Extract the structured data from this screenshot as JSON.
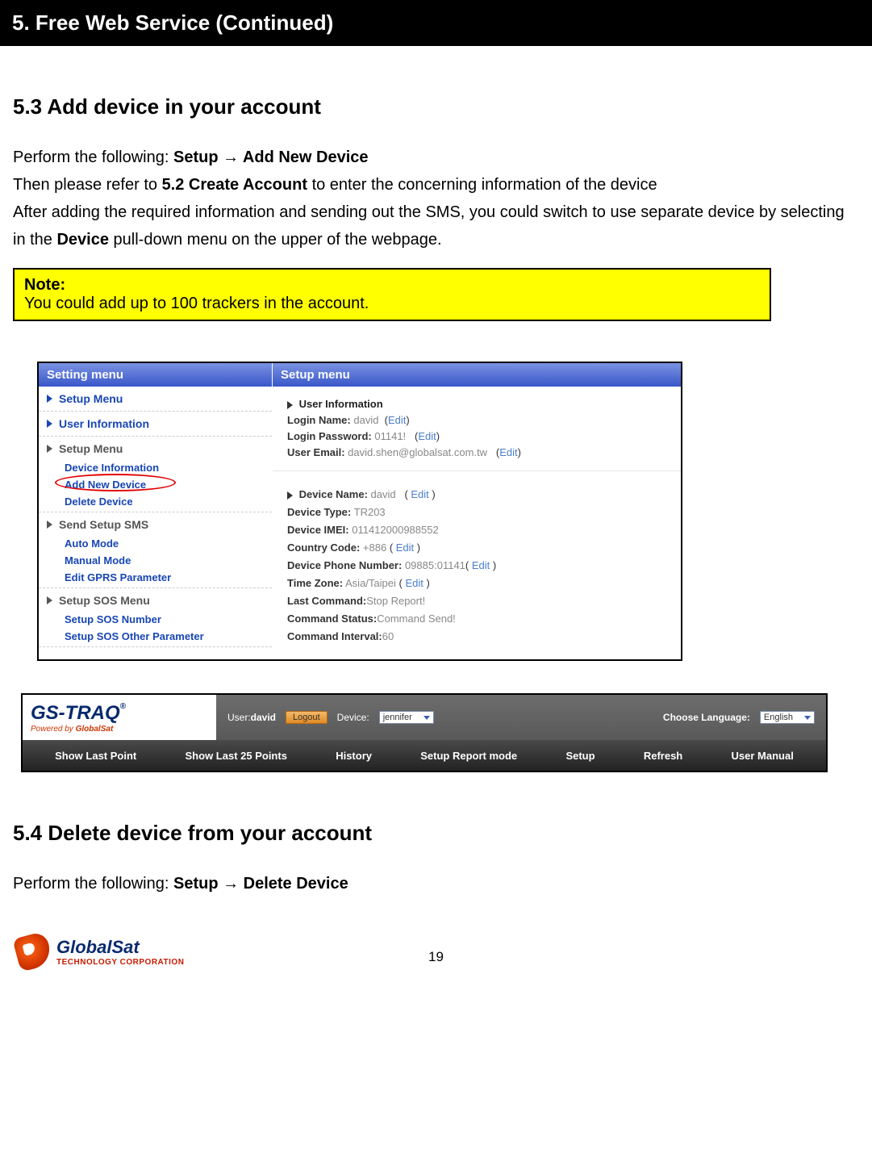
{
  "header": {
    "title": "5. Free Web Service (Continued)"
  },
  "section53": {
    "heading": "5.3 Add device in your account",
    "p1_pre": "Perform the following: ",
    "p1_bold": "Setup → Add New Device",
    "p2_pre": "Then please refer to ",
    "p2_bold": "5.2 Create Account",
    "p2_post": " to enter the concerning information of the device",
    "p3_pre": "After adding the required information and sending out the SMS, you could switch to use separate device by selecting in the ",
    "p3_bold": "Device",
    "p3_post": " pull-down menu on the upper of the webpage."
  },
  "note": {
    "title": "Note:",
    "body": "You could add up to 100 trackers in the account."
  },
  "shot1": {
    "left_header": "Setting menu",
    "right_header": "Setup menu",
    "menu": {
      "m1": "Setup Menu",
      "m2": "User Information",
      "m3": "Setup Menu",
      "m3a": "Device Information",
      "m3b": "Add New Device",
      "m3c": "Delete Device",
      "m4": "Send Setup SMS",
      "m4a": "Auto Mode",
      "m4b": "Manual Mode",
      "m4c": "Edit GPRS Parameter",
      "m5": "Setup SOS Menu",
      "m5a": "Setup SOS Number",
      "m5b": "Setup SOS Other Parameter"
    },
    "user": {
      "section": "User Information",
      "login_name_lbl": "Login Name:",
      "login_name_val": "david",
      "login_pass_lbl": "Login Password:",
      "login_pass_val": "01141!",
      "email_lbl": "User Email:",
      "email_val": "david.shen@globalsat.com.tw",
      "edit": "Edit"
    },
    "device": {
      "name_lbl": "Device Name:",
      "name_val": "david",
      "type_lbl": "Device Type:",
      "type_val": "TR203",
      "imei_lbl": "Device IMEI:",
      "imei_val": "011412000988552",
      "cc_lbl": "Country Code:",
      "cc_val": "+886",
      "phone_lbl": "Device Phone Number:",
      "phone_val": "09885:01141",
      "tz_lbl": "Time Zone:",
      "tz_val": "Asia/Taipei",
      "lastcmd_lbl": "Last Command:",
      "lastcmd_val": "Stop Report!",
      "cmdstat_lbl": "Command Status:",
      "cmdstat_val": "Command Send!",
      "cmdint_lbl": "Command Interval:",
      "cmdint_val": "60",
      "edit": "Edit"
    }
  },
  "shot2": {
    "logo_main": "GS-TRAQ",
    "logo_sub_pre": "Powered by ",
    "logo_sub_bold": "GlobalSat",
    "user_label": "User:",
    "user_value": "david",
    "logout": "Logout",
    "device_label": "Device:",
    "device_value": "jennifer",
    "lang_label": "Choose Language:",
    "lang_value": "English",
    "nav": {
      "a": "Show Last Point",
      "b": "Show Last 25 Points",
      "c": "History",
      "d": "Setup Report mode",
      "e": "Setup",
      "f": "Refresh",
      "g": "User Manual"
    }
  },
  "section54": {
    "heading": "5.4 Delete device from your account",
    "p1_pre": "Perform the following: ",
    "p1_bold": "Setup → Delete Device"
  },
  "footer": {
    "pagenum": "19",
    "logo_big": "GlobalSat",
    "logo_small": "TECHNOLOGY CORPORATION"
  }
}
